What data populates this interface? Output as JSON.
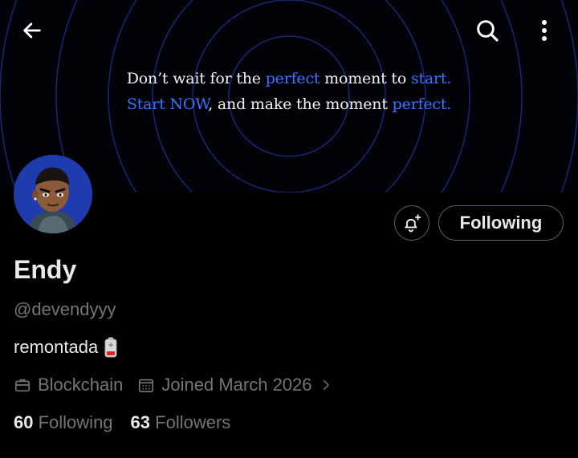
{
  "banner": {
    "line1": {
      "a": "Don’t wait for the ",
      "b": "perfect",
      "c": " moment to ",
      "d": "start."
    },
    "line2": {
      "a": "Start NOW",
      "b": ", and make the moment ",
      "c": "perfect."
    }
  },
  "header": {
    "back_icon": "arrow-left-icon",
    "search_icon": "search-icon",
    "more_icon": "more-vertical-icon"
  },
  "profile": {
    "name": "Endy",
    "handle": "@devendyyy",
    "bio": "remontada",
    "bio_emoji": "battery-low-icon",
    "category": "Blockchain",
    "joined": "Joined March 2026",
    "following_count": "60",
    "following_label": "Following",
    "followers_count": "63",
    "followers_label": "Followers"
  },
  "actions": {
    "follow_state": "Following"
  },
  "colors": {
    "accent_blue": "#3d74ff",
    "secondary_text": "#71767b",
    "primary_text": "#e7e9ea",
    "border": "#536471"
  }
}
